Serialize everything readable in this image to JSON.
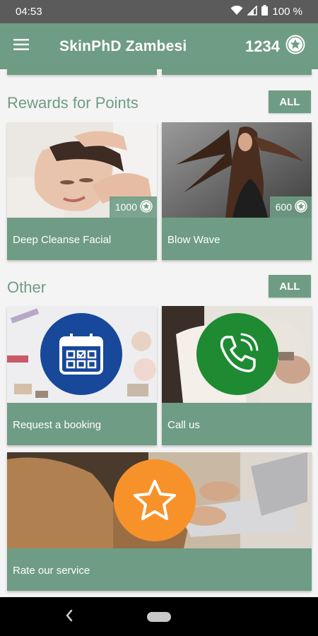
{
  "status": {
    "time": "04:53",
    "battery": "100 %"
  },
  "appbar": {
    "title": "SkinPhD Zambesi",
    "points": "1234"
  },
  "rewards": {
    "title": "Rewards for Points",
    "all_label": "ALL",
    "items": [
      {
        "label": "Deep Cleanse Facial",
        "points": "1000"
      },
      {
        "label": "Blow Wave",
        "points": "600"
      }
    ]
  },
  "other": {
    "title": "Other",
    "all_label": "ALL",
    "items": [
      {
        "label": "Request a booking",
        "icon": "calendar-icon",
        "color": "#17489a"
      },
      {
        "label": "Call us",
        "icon": "phone-icon",
        "color": "#1e8a32"
      },
      {
        "label": "Rate our service",
        "icon": "star-icon",
        "color": "#f7922a"
      }
    ]
  },
  "colors": {
    "brand": "#6f9c84",
    "status_bar": "#5b5b5b"
  }
}
